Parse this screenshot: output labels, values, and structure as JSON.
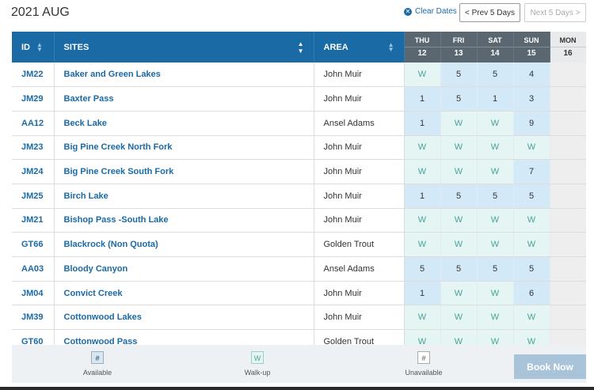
{
  "header": {
    "title": "2021 AUG",
    "clear_dates": "Clear Dates",
    "prev_btn": "< Prev 5 Days",
    "next_btn": "Next 5 Days >"
  },
  "columns": {
    "id": "ID",
    "sites": "SITES",
    "area": "AREA"
  },
  "days": [
    {
      "name": "THU",
      "num": "12"
    },
    {
      "name": "FRI",
      "num": "13"
    },
    {
      "name": "SAT",
      "num": "14"
    },
    {
      "name": "SUN",
      "num": "15"
    },
    {
      "name": "MON",
      "num": "16"
    }
  ],
  "rows": [
    {
      "id": "JM22",
      "site": "Baker and Green Lakes",
      "area": "John Muir",
      "cells": [
        "W",
        "5",
        "5",
        "4",
        ""
      ]
    },
    {
      "id": "JM29",
      "site": "Baxter Pass",
      "area": "John Muir",
      "cells": [
        "1",
        "5",
        "1",
        "3",
        ""
      ]
    },
    {
      "id": "AA12",
      "site": "Beck Lake",
      "area": "Ansel Adams",
      "cells": [
        "1",
        "W",
        "W",
        "9",
        ""
      ]
    },
    {
      "id": "JM23",
      "site": "Big Pine Creek North Fork",
      "area": "John Muir",
      "cells": [
        "W",
        "W",
        "W",
        "W",
        ""
      ]
    },
    {
      "id": "JM24",
      "site": "Big Pine Creek South Fork",
      "area": "John Muir",
      "cells": [
        "W",
        "W",
        "W",
        "7",
        ""
      ]
    },
    {
      "id": "JM25",
      "site": "Birch Lake",
      "area": "John Muir",
      "cells": [
        "1",
        "5",
        "5",
        "5",
        ""
      ]
    },
    {
      "id": "JM21",
      "site": "Bishop Pass -South Lake",
      "area": "John Muir",
      "cells": [
        "W",
        "W",
        "W",
        "W",
        ""
      ]
    },
    {
      "id": "GT66",
      "site": "Blackrock (Non Quota)",
      "area": "Golden Trout",
      "cells": [
        "W",
        "W",
        "W",
        "W",
        ""
      ]
    },
    {
      "id": "AA03",
      "site": "Bloody Canyon",
      "area": "Ansel Adams",
      "cells": [
        "5",
        "5",
        "5",
        "5",
        ""
      ]
    },
    {
      "id": "JM04",
      "site": "Convict Creek",
      "area": "John Muir",
      "cells": [
        "1",
        "W",
        "W",
        "6",
        ""
      ]
    },
    {
      "id": "JM39",
      "site": "Cottonwood Lakes",
      "area": "John Muir",
      "cells": [
        "W",
        "W",
        "W",
        "W",
        ""
      ]
    },
    {
      "id": "GT60",
      "site": "Cottonwood Pass",
      "area": "Golden Trout",
      "cells": [
        "W",
        "W",
        "W",
        "W",
        ""
      ]
    }
  ],
  "legend": {
    "available_symbol": "#",
    "available": "Available",
    "walkup_symbol": "W",
    "walkup": "Walk-up",
    "unavailable_symbol": "#",
    "unavailable": "Unavailable"
  },
  "book_now": "Book Now",
  "colors": {
    "header_blue": "#1a6aa6",
    "day_header_gray": "#5a6770",
    "available_bg": "#d4e9f8",
    "walkup_bg": "#e4f5f3",
    "unavailable_bg": "#eeeeee"
  }
}
